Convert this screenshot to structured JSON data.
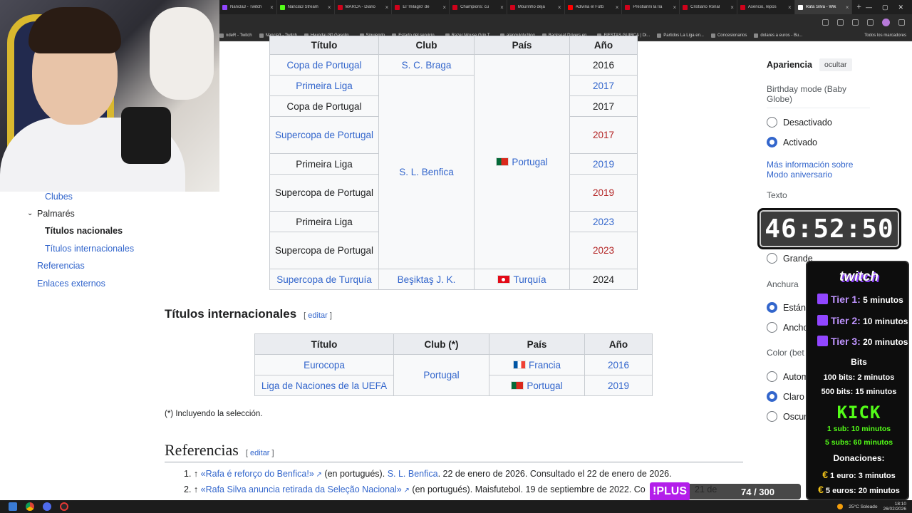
{
  "browser": {
    "tabs": [
      {
        "label": "Nancla3 - Twitch",
        "color": "#9146ff"
      },
      {
        "label": "Nancla3 Stream",
        "color": "#53fc18"
      },
      {
        "label": "MARCA - Diario",
        "color": "#d0021b"
      },
      {
        "label": "El 'milagro' de",
        "color": "#d0021b"
      },
      {
        "label": "Champions: cu",
        "color": "#d0021b"
      },
      {
        "label": "Mourinho deja",
        "color": "#d0021b"
      },
      {
        "label": "Adivina el Fútb",
        "color": "#ff0000"
      },
      {
        "label": "Prestianni la lía",
        "color": "#d0021b"
      },
      {
        "label": "Cristiano Ronal",
        "color": "#d0021b"
      },
      {
        "label": "Asencio, repos",
        "color": "#d0021b"
      },
      {
        "label": "Rafa Silva - Wik",
        "color": "#ffffff",
        "active": true
      }
    ],
    "bookmarks": [
      "ndeR - Twitch",
      "Nancla3 - Twitch",
      "Hyundai i30 Gasolin...",
      "Siguiendo",
      "Estado del servicio...",
      "Razer Mouse Grip T...",
      "alanguloty.blog",
      "Backseat Drivers en...",
      "FIESTAS GUIRCA | Di...",
      "Partidos La Liga en...",
      "Concesionarios",
      "dolares a euros - Bu..."
    ],
    "bookmarks_right": "Todos los marcadores"
  },
  "toc": {
    "clubes": "Clubes",
    "palmares": "Palmarés",
    "titulos_nacionales": "Títulos nacionales",
    "titulos_internacionales": "Títulos internacionales",
    "referencias": "Referencias",
    "enlaces_externos": "Enlaces externos"
  },
  "national_table": {
    "headers": [
      "Título",
      "Club",
      "País",
      "Año"
    ],
    "rows": [
      {
        "titulo": "Copa de Portugal",
        "anio": "2016",
        "titulo_link": true,
        "anio_style": "plain"
      },
      {
        "titulo": "Primeira Liga",
        "anio": "2017",
        "titulo_link": true,
        "anio_style": "link"
      },
      {
        "titulo": "Copa de Portugal",
        "anio": "2017",
        "titulo_link": false,
        "anio_style": "plain"
      },
      {
        "titulo": "Supercopa de Portugal",
        "anio": "2017",
        "titulo_link": true,
        "anio_style": "red"
      },
      {
        "titulo": "Primeira Liga",
        "anio": "2019",
        "titulo_link": false,
        "anio_style": "link"
      },
      {
        "titulo": "Supercopa de Portugal",
        "anio": "2019",
        "titulo_link": false,
        "anio_style": "red"
      },
      {
        "titulo": "Primeira Liga",
        "anio": "2023",
        "titulo_link": false,
        "anio_style": "link"
      },
      {
        "titulo": "Supercopa de Portugal",
        "anio": "2023",
        "titulo_link": false,
        "anio_style": "red"
      },
      {
        "titulo": "Supercopa de Turquía",
        "anio": "2024",
        "titulo_link": true,
        "anio_style": "plain"
      }
    ],
    "club_braga": "S. C. Braga",
    "club_benfica": "S. L. Benfica",
    "club_besiktas": "Beşiktaş J. K.",
    "pais_portugal": "Portugal",
    "pais_turquia": "Turquía"
  },
  "international": {
    "heading": "Títulos internacionales",
    "edit_label": "editar",
    "headers": [
      "Título",
      "Club (*)",
      "País",
      "Año"
    ],
    "rows": [
      {
        "titulo": "Eurocopa",
        "pais": "Francia",
        "anio": "2016"
      },
      {
        "titulo": "Liga de Naciones de la UEFA",
        "pais": "Portugal",
        "anio": "2019"
      }
    ],
    "club": "Portugal",
    "note": "(*) Incluyendo la selección."
  },
  "references": {
    "heading": "Referencias",
    "edit_label": "editar",
    "items": [
      {
        "num": "1. ↑",
        "title": "«Rafa é reforço do Benfica!»",
        "lang": "(en portugués).",
        "source": "S. L. Benfica",
        "rest": ". 22 de enero de 2026. Consultado el 22 de enero de 2026."
      },
      {
        "num": "2. ↑",
        "title": "«Rafa Silva anuncia retirada da Seleção Nacional»",
        "lang": "(en portugués).",
        "source": "",
        "rest": "Maisfutebol. 19 de septiembre de 2022. Co",
        "tail": "21 de"
      }
    ]
  },
  "appearance": {
    "title": "Apariencia",
    "hide_button": "ocultar",
    "birthday_label": "Birthday mode (Baby Globe)",
    "opt_off": "Desactivado",
    "opt_on": "Activado",
    "more_info": "Más información sobre Modo aniversario",
    "text_label": "Texto",
    "text_large": "Grande",
    "width_label": "Anchura",
    "width_standard": "Están",
    "width_wide": "Ancho",
    "color_label": "Color (bet",
    "color_auto": "Autom",
    "color_light": "Claro",
    "color_dark": "Oscur"
  },
  "timer": {
    "value": "46:52:50"
  },
  "subathon": {
    "twitch": "twitch",
    "tiers": [
      {
        "name": "Tier 1:",
        "value": "5 minutos"
      },
      {
        "name": "Tier 2:",
        "value": "10 minutos"
      },
      {
        "name": "Tier 3:",
        "value": "20 minutos"
      }
    ],
    "bits_title": "Bits",
    "bits": [
      "100 bits: 2 minutos",
      "500 bits: 15 minutos"
    ],
    "kick": "KICK",
    "kick_lines": [
      "1 sub: 10 minutos",
      "5 subs: 60 minutos"
    ],
    "donations_title": "Donaciones:",
    "donations": [
      {
        "amount": "1 euro:",
        "value": "3 minutos"
      },
      {
        "amount": "5 euros:",
        "value": "20 minutos"
      }
    ]
  },
  "plus": {
    "badge": "!PLUS",
    "count": "74 / 300"
  },
  "taskbar": {
    "weather": "25°C  Soleado",
    "time": "18:10",
    "date": "26/02/2026"
  }
}
